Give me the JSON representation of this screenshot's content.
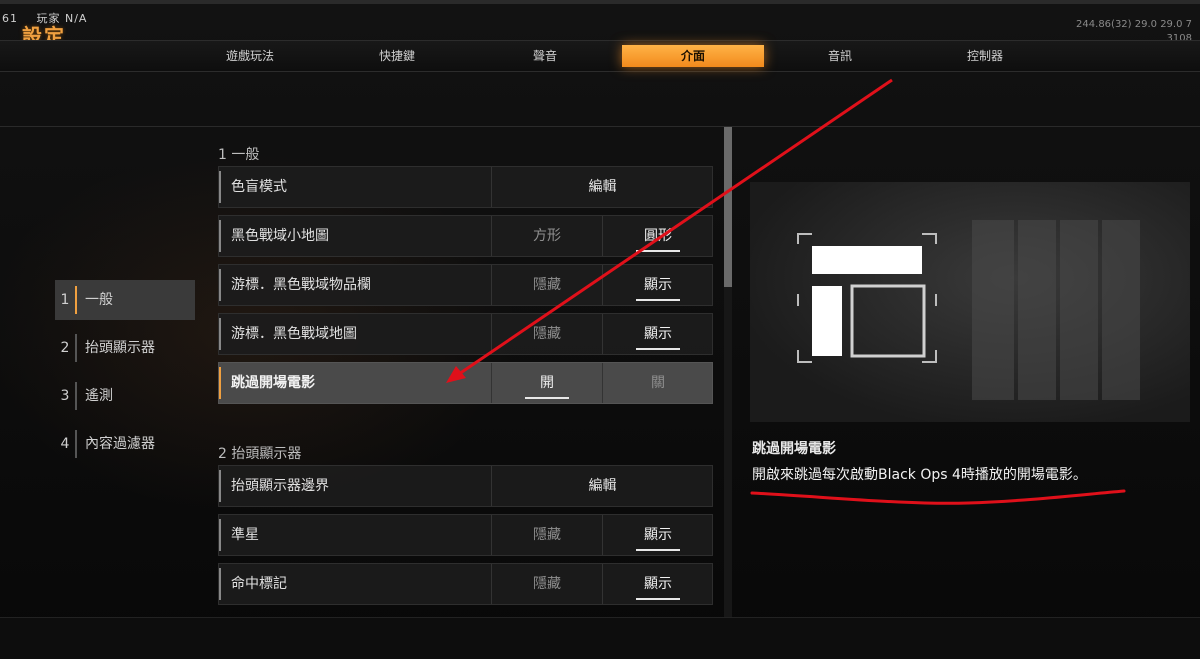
{
  "top_status": {
    "level": "61",
    "name": "玩家",
    "rank": "N/A"
  },
  "page_title": "設定",
  "right_info": {
    "line1": "244.86(32) 29.0 29.0 7",
    "line2": "3108"
  },
  "tabs": [
    {
      "label": "遊戲玩法"
    },
    {
      "label": "快捷鍵"
    },
    {
      "label": "聲音"
    },
    {
      "label": "介面",
      "active": true
    },
    {
      "label": "音訊"
    },
    {
      "label": "控制器"
    }
  ],
  "nav": [
    {
      "num": "1",
      "label": "一般",
      "active": true
    },
    {
      "num": "2",
      "label": "抬頭顯示器"
    },
    {
      "num": "3",
      "label": "遙測"
    },
    {
      "num": "4",
      "label": "內容過濾器"
    }
  ],
  "sections": [
    {
      "title": "1 一般"
    },
    {
      "title": "2 抬頭顯示器"
    }
  ],
  "rows": [
    {
      "label": "色盲模式",
      "single": "編輯"
    },
    {
      "label": "黑色戰域小地圖",
      "opt1": "方形",
      "opt2": "圓形",
      "selected": 2
    },
    {
      "label": "游標．黑色戰域物品欄",
      "opt1": "隱藏",
      "opt2": "顯示",
      "selected": 2
    },
    {
      "label": "游標．黑色戰域地圖",
      "opt1": "隱藏",
      "opt2": "顯示",
      "selected": 2
    },
    {
      "label": "跳過開場電影",
      "opt1": "開",
      "opt2": "關",
      "selected": 1,
      "active": true
    },
    {
      "label": "抬頭顯示器邊界",
      "single": "編輯"
    },
    {
      "label": "準星",
      "opt1": "隱藏",
      "opt2": "顯示",
      "selected": 2
    },
    {
      "label": "命中標記",
      "opt1": "隱藏",
      "opt2": "顯示",
      "selected": 2
    }
  ],
  "description": {
    "title": "跳過開場電影",
    "text": "開啟來跳過每次啟動Black Ops 4時播放的開場電影。"
  },
  "colors": {
    "accent": "#f0a040",
    "annotation": "#e0101a"
  }
}
